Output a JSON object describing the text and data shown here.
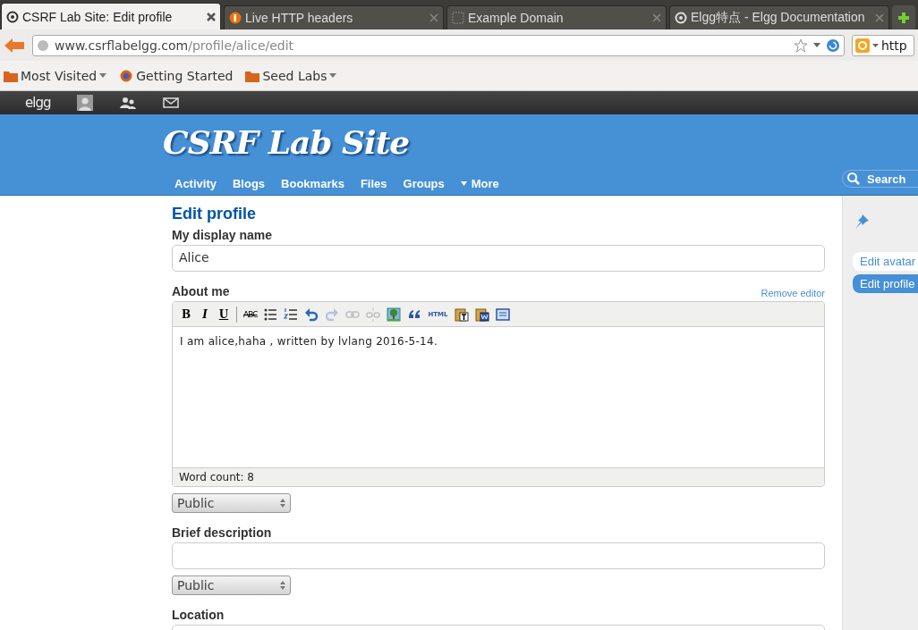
{
  "browser": {
    "tabs": [
      {
        "title": "CSRF Lab Site: Edit profile",
        "selected": true
      },
      {
        "title": "Live HTTP headers",
        "selected": false
      },
      {
        "title": "Example Domain",
        "selected": false
      },
      {
        "title": "Elgg特点 - Elgg Documentation",
        "selected": false
      }
    ],
    "url": {
      "host": "www.csrflabelgg.com",
      "path": "/profile/alice/edit"
    },
    "search_text": "http",
    "bookmarks": [
      {
        "label": "Most Visited",
        "dropdown": true
      },
      {
        "label": "Getting Started",
        "dropdown": false
      },
      {
        "label": "Seed Labs",
        "dropdown": true
      }
    ]
  },
  "topbar": {
    "logo": "elgg"
  },
  "site": {
    "title": "CSRF Lab Site",
    "nav": [
      {
        "label": "Activity",
        "kind": "link"
      },
      {
        "label": "Blogs",
        "kind": "link"
      },
      {
        "label": "Bookmarks",
        "kind": "link"
      },
      {
        "label": "Files",
        "kind": "link"
      },
      {
        "label": "Groups",
        "kind": "link"
      },
      {
        "label": "More",
        "kind": "menu"
      }
    ],
    "search": {
      "placeholder": "Search"
    }
  },
  "form": {
    "title": "Edit profile",
    "fields": [
      {
        "kind": "text",
        "label": "My display name",
        "value": "Alice"
      },
      {
        "kind": "rich",
        "label": "About me",
        "remove_link": "Remove editor",
        "value": "I am alice,haha , written by lvlang 2016-5-14.",
        "word_count": "Word count: 8",
        "access": "Public",
        "toolbar": [
          {
            "kind": "bold",
            "label": "B",
            "disabled": false
          },
          {
            "kind": "italic",
            "label": "I",
            "disabled": false
          },
          {
            "kind": "underline",
            "label": "U",
            "disabled": false
          },
          {
            "kind": "separator"
          },
          {
            "kind": "strike",
            "label": "ABC",
            "disabled": false
          },
          {
            "kind": "bullets",
            "disabled": false
          },
          {
            "kind": "numbers",
            "disabled": false
          },
          {
            "kind": "undo",
            "disabled": false
          },
          {
            "kind": "redo",
            "disabled": true
          },
          {
            "kind": "link",
            "disabled": true
          },
          {
            "kind": "unlink",
            "disabled": true
          },
          {
            "kind": "image",
            "disabled": false
          },
          {
            "kind": "quote",
            "disabled": false
          },
          {
            "kind": "html",
            "label": "HTML",
            "disabled": false
          },
          {
            "kind": "paste-text",
            "disabled": false
          },
          {
            "kind": "paste-word",
            "disabled": false
          },
          {
            "kind": "fullscreen",
            "disabled": false
          }
        ]
      },
      {
        "kind": "text",
        "label": "Brief description",
        "access": "Public"
      },
      {
        "kind": "text",
        "label": "Location"
      }
    ]
  },
  "sidebar": {
    "items": [
      {
        "label": "Edit avatar",
        "selected": false
      },
      {
        "label": "Edit profile",
        "selected": true
      }
    ]
  }
}
